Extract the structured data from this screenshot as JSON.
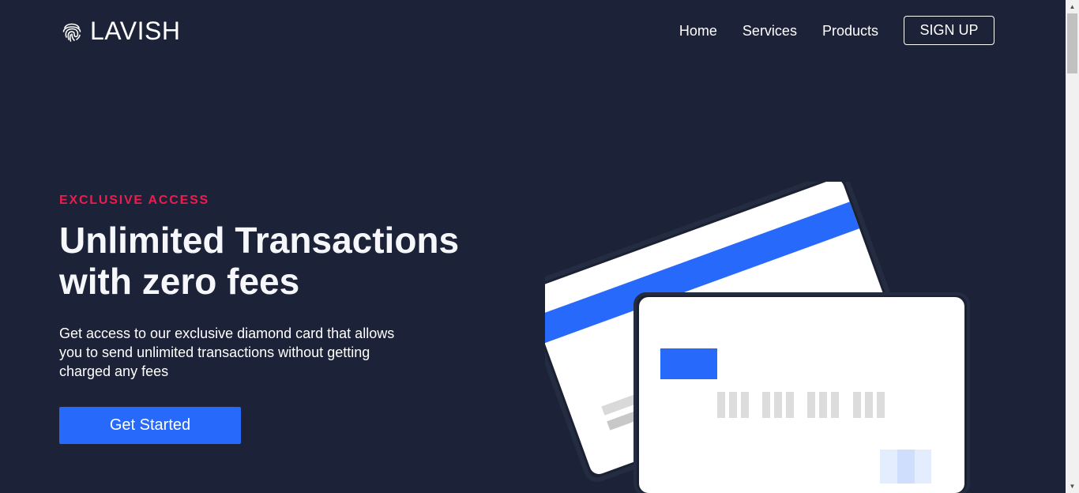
{
  "brand": {
    "name": "LAVISH",
    "icon": "fingerprint-icon"
  },
  "nav": {
    "links": [
      "Home",
      "Services",
      "Products"
    ],
    "signup_label": "SIGN UP"
  },
  "hero": {
    "eyebrow": "EXCLUSIVE ACCESS",
    "headline_line1": "Unlimited Transactions",
    "headline_line2": "with zero fees",
    "description": "Get access to our exclusive diamond card that allows you to send unlimited transactions without getting charged any fees",
    "cta_label": "Get Started"
  },
  "colors": {
    "background": "#1c2237",
    "accent": "#276afb",
    "eyebrow": "#ef1b4f",
    "text": "#ffffff"
  },
  "scrollbar": {
    "up_icon": "triangle-up-icon",
    "down_icon": "triangle-down-icon"
  }
}
